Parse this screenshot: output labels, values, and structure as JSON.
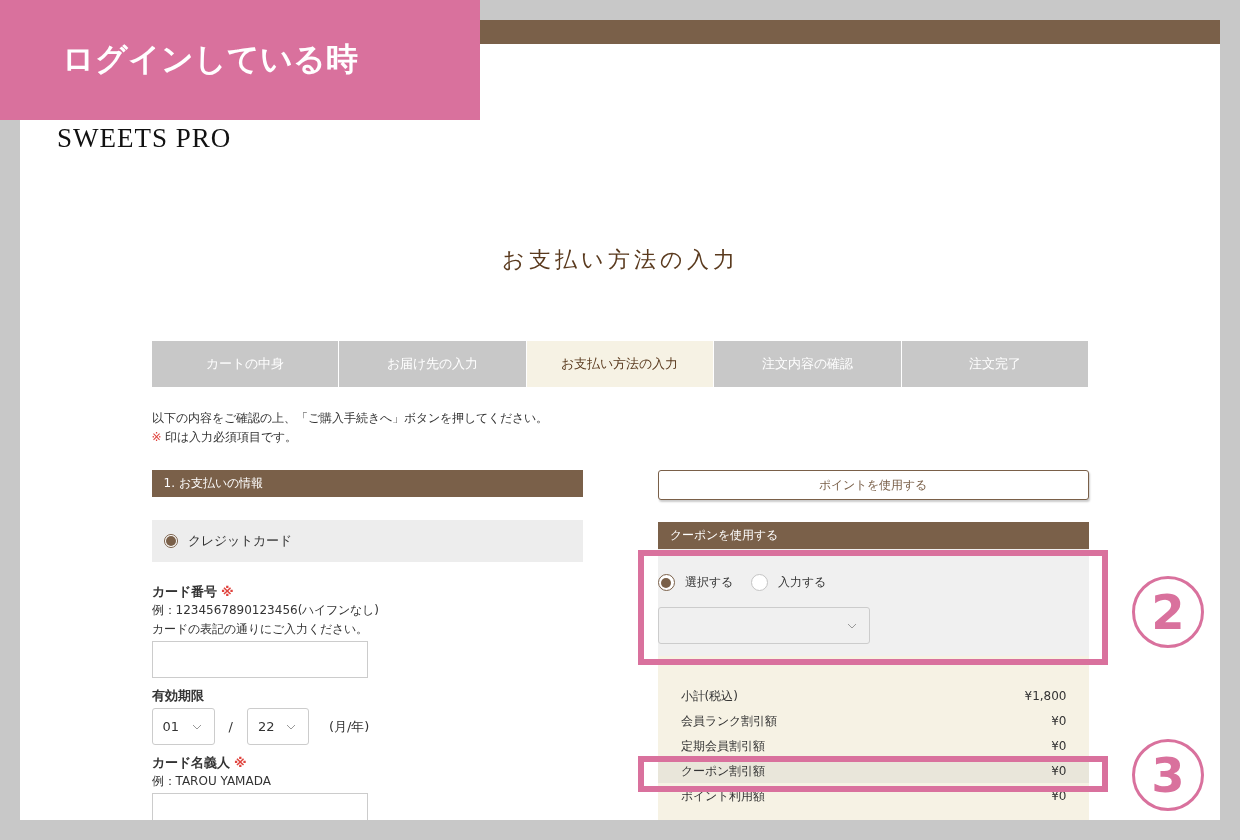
{
  "annotation_label": "ログインしている時",
  "logo": "SWEETS PRO",
  "title": "お支払い方法の入力",
  "steps": [
    {
      "label": "カートの中身",
      "selected": false
    },
    {
      "label": "お届け先の入力",
      "selected": false
    },
    {
      "label": "お支払い方法の入力",
      "selected": true
    },
    {
      "label": "注文内容の確認",
      "selected": false
    },
    {
      "label": "注文完了",
      "selected": false
    }
  ],
  "intro": {
    "text": "以下の内容をご確認の上、「ご購入手続きへ」ボタンを押してください。",
    "note_mark": "※",
    "note": "印は入力必須項目です。"
  },
  "payment": {
    "heading": "1. お支払いの情報",
    "methods": [
      {
        "label": "クレジットカード",
        "selected": true
      }
    ],
    "card_number": {
      "label": "カード番号",
      "required_mark": "※",
      "hints": [
        "例：1234567890123456(ハイフンなし)",
        "カードの表記の通りにご入力ください。"
      ]
    },
    "expiry": {
      "label": "有効期限",
      "month": "01",
      "separator": "/",
      "year": "22",
      "suffix": "(月/年)"
    },
    "card_name": {
      "label": "カード名義人",
      "required_mark": "※",
      "hints": [
        "例：TAROU YAMADA"
      ]
    }
  },
  "points_button": "ポイントを使用する",
  "coupon": {
    "heading": "クーポンを使用する",
    "options": [
      {
        "label": "選択する",
        "selected": true
      },
      {
        "label": "入力する",
        "selected": false
      }
    ]
  },
  "summary": [
    {
      "label": "小計(税込)",
      "value": "¥1,800",
      "highlighted": false
    },
    {
      "label": "会員ランク割引額",
      "value": "¥0",
      "highlighted": false
    },
    {
      "label": "定期会員割引額",
      "value": "¥0",
      "highlighted": false
    },
    {
      "label": "クーポン割引額",
      "value": "¥0",
      "highlighted": true
    },
    {
      "label": "ポイント利用額",
      "value": "¥0",
      "highlighted": false
    }
  ],
  "annotations": [
    {
      "number": "2"
    },
    {
      "number": "3"
    }
  ]
}
